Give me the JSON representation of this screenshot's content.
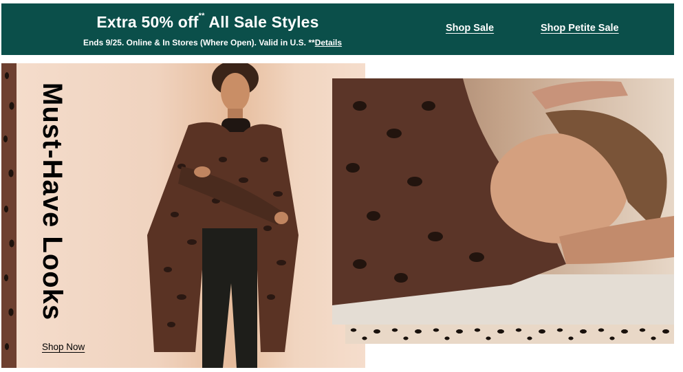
{
  "promo": {
    "headline": "Extra 50% off",
    "headline_sup": "**",
    "headline_rest": "All Sale Styles",
    "subline": "Ends 9/25. Online & In Stores (Where Open). Valid in U.S. **",
    "details_label": "Details",
    "shop_sale_label": "Shop Sale",
    "shop_petite_label": "Shop Petite Sale"
  },
  "hero_left": {
    "title": "Must-Have Looks",
    "cta_label": "Shop Now"
  },
  "colors": {
    "banner_bg": "#0b4f4a",
    "banner_text": "#ffffff",
    "hero_bg": "#f0d3bf",
    "leopard_brown": "#6e4030"
  }
}
